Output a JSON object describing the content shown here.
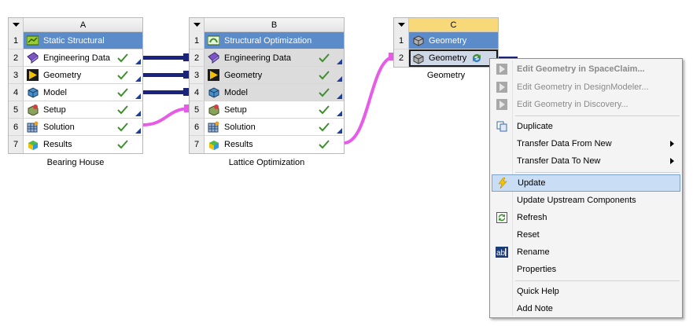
{
  "systems": [
    {
      "letter": "A",
      "caption": "Bearing House",
      "rows": [
        {
          "num": "1",
          "label": "Static Structural",
          "icon": "static-structural-icon"
        },
        {
          "num": "2",
          "label": "Engineering Data",
          "icon": "engineering-data-icon"
        },
        {
          "num": "3",
          "label": "Geometry",
          "icon": "geometry-icon"
        },
        {
          "num": "4",
          "label": "Model",
          "icon": "model-icon"
        },
        {
          "num": "5",
          "label": "Setup",
          "icon": "setup-icon"
        },
        {
          "num": "6",
          "label": "Solution",
          "icon": "solution-icon"
        },
        {
          "num": "7",
          "label": "Results",
          "icon": "results-icon"
        }
      ]
    },
    {
      "letter": "B",
      "caption": "Lattice Optimization",
      "rows": [
        {
          "num": "1",
          "label": "Structural Optimization",
          "icon": "structural-optimization-icon"
        },
        {
          "num": "2",
          "label": "Engineering Data",
          "icon": "engineering-data-icon"
        },
        {
          "num": "3",
          "label": "Geometry",
          "icon": "geometry-icon"
        },
        {
          "num": "4",
          "label": "Model",
          "icon": "model-icon"
        },
        {
          "num": "5",
          "label": "Setup",
          "icon": "setup-icon"
        },
        {
          "num": "6",
          "label": "Solution",
          "icon": "solution-icon"
        },
        {
          "num": "7",
          "label": "Results",
          "icon": "results-icon"
        }
      ]
    },
    {
      "letter": "C",
      "caption": "Geometry",
      "rows": [
        {
          "num": "1",
          "label": "Geometry",
          "icon": "geometry-box-icon"
        },
        {
          "num": "2",
          "label": "Geometry",
          "icon": "geometry-box-icon"
        }
      ]
    }
  ],
  "context_menu": {
    "items": [
      {
        "label": "Edit Geometry in SpaceClaim...",
        "state": "bold-disabled",
        "icon": "play-icon"
      },
      {
        "label": "Edit Geometry in DesignModeler...",
        "state": "disabled",
        "icon": "play-icon"
      },
      {
        "label": "Edit Geometry in Discovery...",
        "state": "disabled",
        "icon": "play-icon"
      },
      {
        "label": "Duplicate",
        "icon": "duplicate-icon"
      },
      {
        "label": "Transfer Data From New",
        "icon": "",
        "submenu": true
      },
      {
        "label": "Transfer Data To New",
        "icon": "",
        "submenu": true
      },
      {
        "label": "Update",
        "icon": "lightning-icon",
        "state": "highlight"
      },
      {
        "label": "Update Upstream Components",
        "icon": ""
      },
      {
        "label": "Refresh",
        "icon": "refresh-icon"
      },
      {
        "label": "Reset",
        "icon": ""
      },
      {
        "label": "Rename",
        "icon": "rename-icon"
      },
      {
        "label": "Properties",
        "icon": ""
      },
      {
        "label": "Quick Help",
        "icon": ""
      },
      {
        "label": "Add Note",
        "icon": ""
      }
    ]
  },
  "colors": {
    "title_blue": "#5b8bc9",
    "link_navy": "#1a237e",
    "link_magenta": "#e65ce6",
    "check_green": "#3f8f2f",
    "active_header": "#f7d97a"
  }
}
